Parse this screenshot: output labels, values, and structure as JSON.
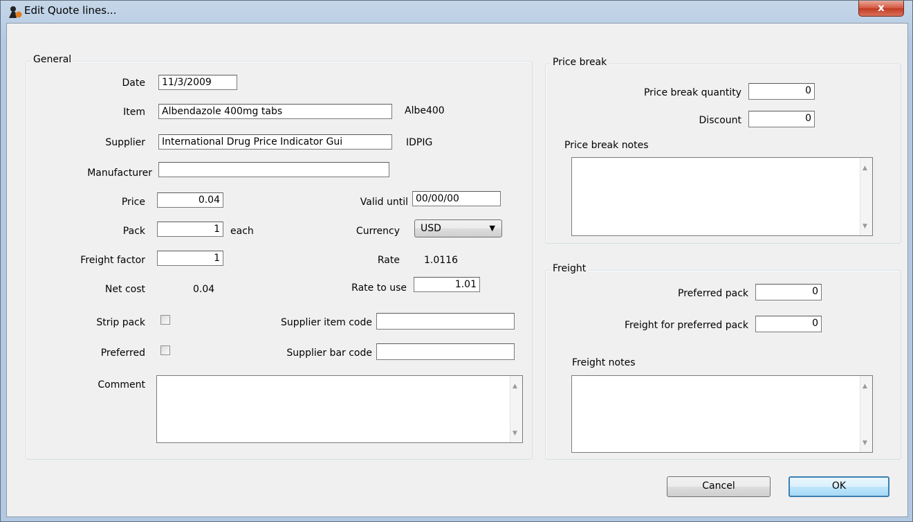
{
  "window": {
    "title": "Edit Quote lines...",
    "close_symbol": "x"
  },
  "general": {
    "legend": "General",
    "date_label": "Date",
    "date_value": "11/3/2009",
    "item_label": "Item",
    "item_value": "Albendazole 400mg tabs",
    "item_code": "Albe400",
    "supplier_label": "Supplier",
    "supplier_value": "International Drug Price Indicator Gui",
    "supplier_code": "IDPIG",
    "manufacturer_label": "Manufacturer",
    "manufacturer_value": "",
    "price_label": "Price",
    "price_value": "0.04",
    "pack_label": "Pack",
    "pack_value": "1",
    "pack_unit": "each",
    "freight_factor_label": "Freight factor",
    "freight_factor_value": "1",
    "net_cost_label": "Net cost",
    "net_cost_value": "0.04",
    "valid_until_label": "Valid until",
    "valid_until_value": "00/00/00",
    "currency_label": "Currency",
    "currency_value": "USD",
    "rate_label": "Rate",
    "rate_value": "1.0116",
    "rate_to_use_label": "Rate to use",
    "rate_to_use_value": "1.01",
    "strip_pack_label": "Strip pack",
    "strip_pack_checked": false,
    "preferred_label": "Preferred",
    "preferred_checked": false,
    "supplier_item_code_label": "Supplier item code",
    "supplier_item_code_value": "",
    "supplier_bar_code_label": "Supplier bar code",
    "supplier_bar_code_value": "",
    "comment_label": "Comment",
    "comment_value": ""
  },
  "price_break": {
    "legend": "Price break",
    "quantity_label": "Price break quantity",
    "quantity_value": "0",
    "discount_label": "Discount",
    "discount_value": "0",
    "notes_label": "Price break notes",
    "notes_value": ""
  },
  "freight": {
    "legend": "Freight",
    "preferred_pack_label": "Preferred pack",
    "preferred_pack_value": "0",
    "freight_for_pack_label": "Freight for preferred pack",
    "freight_for_pack_value": "0",
    "notes_label": "Freight notes",
    "notes_value": ""
  },
  "buttons": {
    "cancel": "Cancel",
    "ok": "OK"
  }
}
